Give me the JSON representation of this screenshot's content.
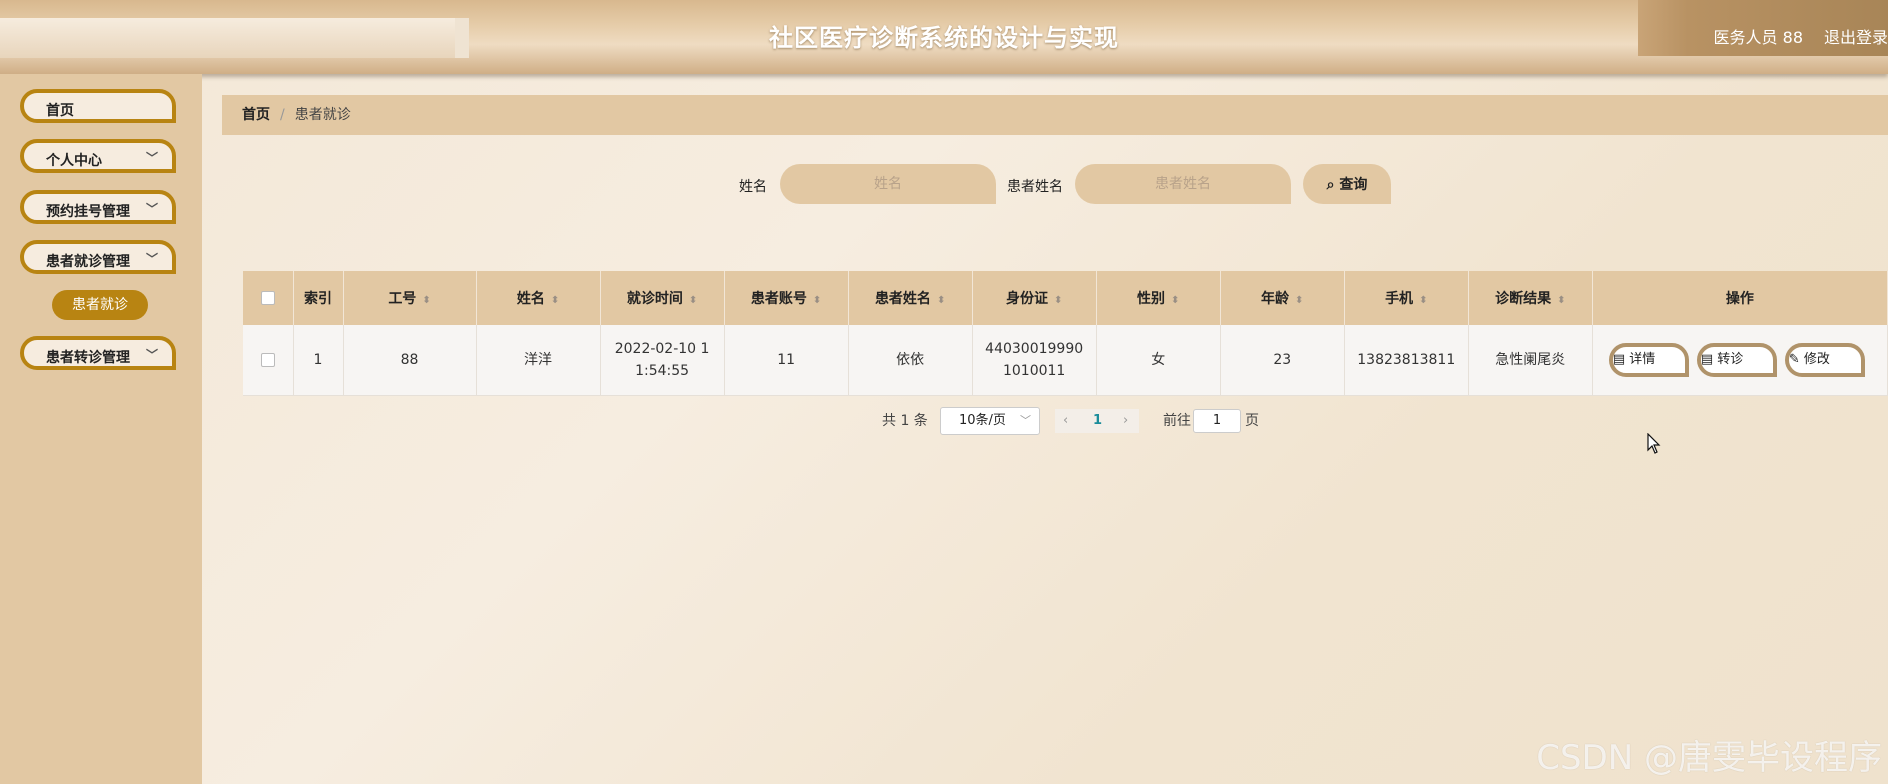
{
  "header": {
    "title": "社区医疗诊断系统的设计与实现",
    "user": "医务人员 88",
    "logout": "退出登录"
  },
  "sidebar": {
    "items": [
      {
        "label": "首页"
      },
      {
        "label": "个人中心"
      },
      {
        "label": "预约挂号管理"
      },
      {
        "label": "患者就诊管理"
      },
      {
        "label": "患者转诊管理"
      }
    ],
    "sub_active": "患者就诊"
  },
  "breadcrumb": {
    "home": "首页",
    "sep": "/",
    "current": "患者就诊"
  },
  "search": {
    "name_label": "姓名",
    "name_placeholder": "姓名",
    "patient_label": "患者姓名",
    "patient_placeholder": "患者姓名",
    "button": "查询"
  },
  "table": {
    "headers": [
      "索引",
      "工号",
      "姓名",
      "就诊时间",
      "患者账号",
      "患者姓名",
      "身份证",
      "性别",
      "年龄",
      "手机",
      "诊断结果",
      "操作"
    ],
    "rows": [
      {
        "index": "1",
        "work_no": "88",
        "name": "洋洋",
        "visit_time": "2022-02-10 11:54:55",
        "account": "11",
        "patient_name": "依依",
        "id_card": "440300199901010011",
        "gender": "女",
        "age": "23",
        "phone": "13823813811",
        "result": "急性阑尾炎",
        "actions": [
          "详情",
          "转诊",
          "修改"
        ]
      }
    ]
  },
  "pagination": {
    "total": "共 1 条",
    "page_size": "10条/页",
    "current": "1",
    "goto_label": "前往",
    "goto_value": "1",
    "page_unit": "页"
  },
  "watermark": "CSDN @唐雯毕设程序"
}
